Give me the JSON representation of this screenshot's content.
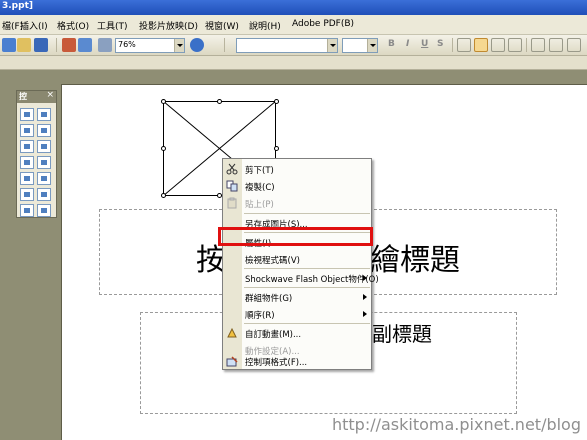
{
  "window": {
    "title": "3.ppt]"
  },
  "menubar": {
    "items": [
      "檔(F)",
      "插入(I)",
      "格式(O)",
      "工具(T)",
      "投影片放映(D)",
      "視窗(W)",
      "說明(H)",
      "Adobe PDF(B)"
    ]
  },
  "toolbar": {
    "zoom": "76%",
    "font_name": "",
    "font_size": "",
    "bold": "B",
    "italic": "I",
    "underline": "U",
    "shadow": "S"
  },
  "toolbox": {
    "title": "控",
    "close": "×"
  },
  "slide": {
    "title_left": "按",
    "title_right": "繪標題",
    "subtitle": "副標題"
  },
  "context_menu": {
    "items": [
      {
        "label": "剪下(T)",
        "icon": "scissors-icon",
        "disabled": false
      },
      {
        "label": "複製(C)",
        "icon": "copy-icon",
        "disabled": false
      },
      {
        "label": "貼上(P)",
        "icon": "paste-icon",
        "disabled": true
      },
      {
        "label": "另存成圖片(S)...",
        "icon": "",
        "disabled": false
      },
      {
        "label": "屬性(I)",
        "icon": "",
        "disabled": false,
        "highlighted": true
      },
      {
        "label": "檢視程式碼(V)",
        "icon": "",
        "disabled": false
      },
      {
        "label": "Shockwave Flash Object物件(O)",
        "icon": "",
        "disabled": false,
        "submenu": true
      },
      {
        "label": "群組物件(G)",
        "icon": "",
        "disabled": false,
        "submenu": true
      },
      {
        "label": "順序(R)",
        "icon": "",
        "disabled": false,
        "submenu": true
      },
      {
        "label": "自訂動畫(M)...",
        "icon": "animation-icon",
        "disabled": false
      },
      {
        "label": "動作設定(A)...",
        "icon": "",
        "disabled": true
      },
      {
        "label": "控制項格式(F)...",
        "icon": "format-icon",
        "disabled": false
      }
    ],
    "highlight_color": "#e01010"
  },
  "watermark": "http://askitoma.pixnet.net/blog"
}
